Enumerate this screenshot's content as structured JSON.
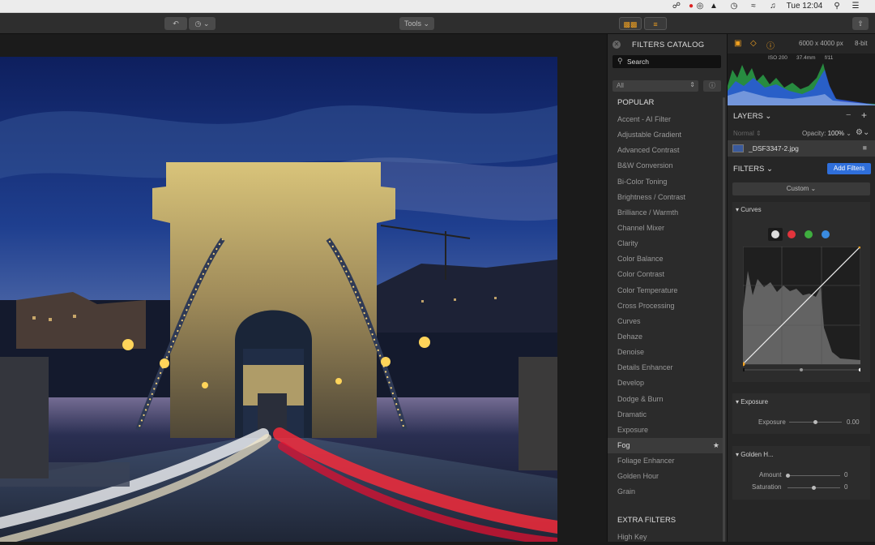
{
  "menubar": {
    "time": "Tue 12:04"
  },
  "toolbar": {
    "tools_label": "Tools ⌄"
  },
  "catalog": {
    "title": "FILTERS CATALOG",
    "search_placeholder": "Search",
    "category_select": "All",
    "popular_header": "POPULAR",
    "items": [
      "Accent - AI Filter",
      "Adjustable Gradient",
      "Advanced Contrast",
      "B&W Conversion",
      "Bi-Color Toning",
      "Brightness / Contrast",
      "Brilliance / Warmth",
      "Channel Mixer",
      "Clarity",
      "Color Balance",
      "Color Contrast",
      "Color Temperature",
      "Cross Processing",
      "Curves",
      "Dehaze",
      "Denoise",
      "Details Enhancer",
      "Develop",
      "Dodge & Burn",
      "Dramatic",
      "Exposure",
      "Fog",
      "Foliage Enhancer",
      "Golden Hour",
      "Grain"
    ],
    "active_item": "Fog",
    "extra_header": "EXTRA FILTERS",
    "extra_items": [
      "High Key"
    ]
  },
  "info": {
    "dimensions": "6000 x 4000 px",
    "bitdepth": "8-bit",
    "iso": "ISO 200",
    "focal": "37.4mm",
    "aperture": "f/11"
  },
  "layers": {
    "title": "LAYERS",
    "blend_mode": "Normal",
    "opacity_label": "Opacity:",
    "opacity_value": "100%",
    "layer_name": "_DSF3347-2.jpg"
  },
  "filters": {
    "title": "FILTERS",
    "add_button": "Add Filters",
    "preset": "Custom",
    "curves": {
      "title": "Curves"
    },
    "exposure": {
      "title": "Exposure",
      "label": "Exposure",
      "value": "0.00",
      "level": 0.5
    },
    "golden_hour": {
      "title": "Golden H...",
      "amount_label": "Amount",
      "amount_value": "0",
      "amount_level": 0,
      "saturation_label": "Saturation",
      "saturation_value": "0",
      "saturation_level": 0.5
    }
  },
  "colors": {
    "accent": "#2f6fdb",
    "toolbar_active": "#f0a020"
  }
}
